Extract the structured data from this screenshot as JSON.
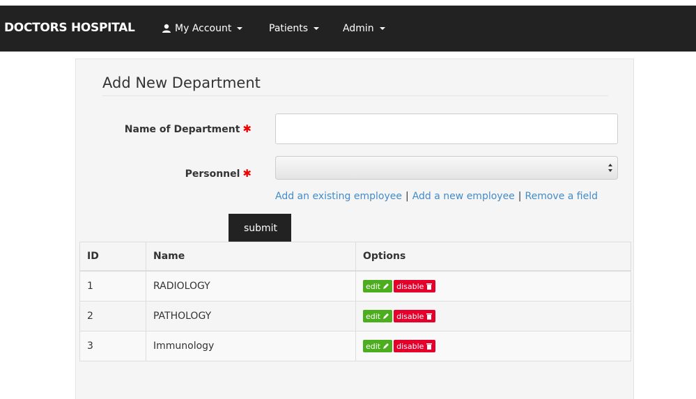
{
  "navbar": {
    "brand": "DOCTORS HOSPITAL",
    "items": [
      {
        "label": "My Account",
        "icon": "user-icon"
      },
      {
        "label": "Patients"
      },
      {
        "label": "Admin"
      }
    ]
  },
  "form": {
    "title": "Add New Department",
    "name_label": "Name of Department",
    "name_value": "",
    "personnel_label": "Personnel",
    "personnel_value": "",
    "required_marker": "✱",
    "links": {
      "add_existing": "Add an existing employee",
      "add_new": "Add a new employee",
      "remove": "Remove a field",
      "separator": "|"
    },
    "submit_label": "submit"
  },
  "table": {
    "headers": [
      "ID",
      "Name",
      "Options"
    ],
    "rows": [
      {
        "id": "1",
        "name": "RADIOLOGY"
      },
      {
        "id": "2",
        "name": "PATHOLOGY"
      },
      {
        "id": "3",
        "name": "Immunology"
      }
    ],
    "edit_label": "edit",
    "disable_label": "disable"
  },
  "colors": {
    "navbar": "#222222",
    "link": "#428bca",
    "edit": "#4cae1e",
    "disable": "#e4002b",
    "required": "#ee0000"
  }
}
